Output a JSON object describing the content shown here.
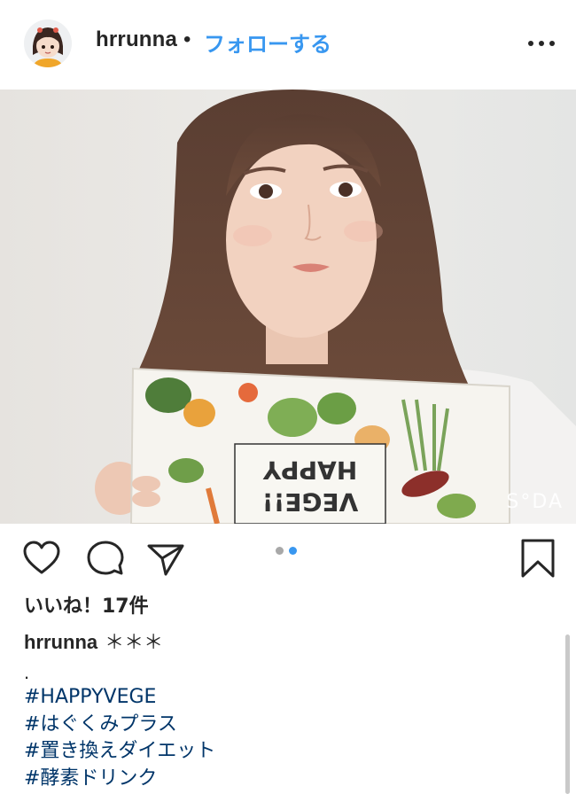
{
  "header": {
    "username": "hrrunna",
    "separator": "•",
    "follow_label": "フォローする"
  },
  "photo": {
    "watermark": "S°DA",
    "box_text_line1": "HAPPY",
    "box_text_line2": "VEGE!!"
  },
  "colors": {
    "follow_blue": "#3897f0",
    "hashtag_blue": "#003569",
    "text_dark": "#262626",
    "pager_active": "#3897f0",
    "pager_inactive": "#a8a8a8"
  },
  "pager": {
    "count": 2,
    "active_index": 1
  },
  "likes": {
    "label": "いいね！17件"
  },
  "caption": {
    "username": "hrrunna",
    "text": "＊＊＊",
    "dot": ".",
    "hashtags": [
      "#HAPPYVEGE",
      "#はぐくみプラス",
      "#置き換えダイエット",
      "#酵素ドリンク"
    ]
  },
  "icons": [
    "heart-icon",
    "comment-icon",
    "share-icon",
    "bookmark-icon",
    "more-options-icon"
  ]
}
